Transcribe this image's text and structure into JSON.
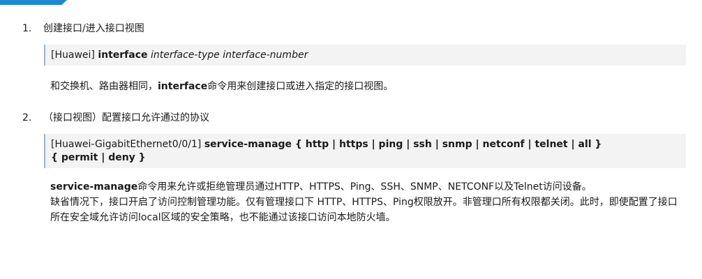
{
  "items": [
    {
      "number": "1.",
      "title": "创建接口/进入接口视图",
      "command": {
        "prompt": "[Huawei]",
        "keyword": "interface",
        "param1": "interface-type",
        "param2": "interface-number"
      },
      "description": {
        "prefix": "和交换机、路由器相同，",
        "keyword": "interface",
        "suffix": "命令用来创建接口或进入指定的接口视图。"
      }
    },
    {
      "number": "2.",
      "title": "（接口视图）配置接口允许通过的协议",
      "command": {
        "prompt": "[Huawei-GigabitEthernet0/0/1]",
        "line1": "service-manage { http | https | ping | ssh | snmp | netconf | telnet | all }",
        "line2": "{ permit | deny }"
      },
      "description": {
        "keyword": "service-manage",
        "text": "命令用来允许或拒绝管理员通过HTTP、HTTPS、Ping、SSH、SNMP、NETCONF以及Telnet访问设备。",
        "note": "缺省情况下，接口开启了访问控制管理功能。仅有管理接口下 HTTP、HTTPS、Ping权限放开。非管理口所有权限都关闭。此时，即使配置了接口所在安全域允许访问local区域的安全策略，也不能通过该接口访问本地防火墙。"
      }
    }
  ],
  "colors": {
    "accent": "#1e88d8",
    "command_bg": "#f3f3f3",
    "command_border": "#8fb4de"
  }
}
